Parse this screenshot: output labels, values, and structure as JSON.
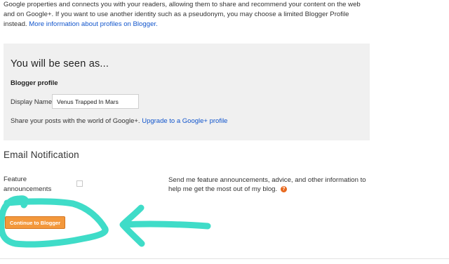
{
  "intro": {
    "text": "Google properties and connects you with your readers, allowing them to share and recommend your content on the web and on Google+. If you want to use another identity such as a pseudonym, you may choose a limited Blogger Profile instead. ",
    "link": "More information about profiles on Blogger."
  },
  "profile": {
    "heading": "You will be seen as...",
    "profile_label": "Blogger profile",
    "display_name_label": "Display Name",
    "display_name_value": "Venus Trapped In Mars",
    "share_text": "Share your posts with the world of Google+. ",
    "upgrade_link": "Upgrade to a Google+ profile"
  },
  "email": {
    "heading": "Email Notification",
    "feature_label": "Feature announcements",
    "feature_desc": "Send me feature announcements, advice, and other information to help me get the most out of my blog.",
    "help_glyph": "?"
  },
  "actions": {
    "continue_label": "Continue to Blogger"
  },
  "annotation": {
    "color": "#3fdcc8"
  }
}
